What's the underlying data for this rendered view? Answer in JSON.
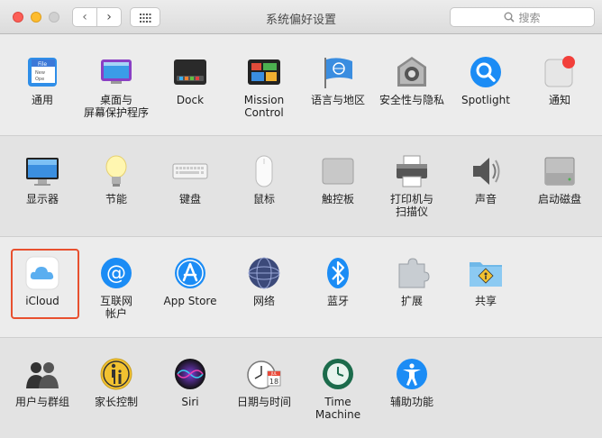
{
  "window": {
    "title": "系统偏好设置"
  },
  "toolbar": {
    "back": "‹",
    "forward": "›"
  },
  "search": {
    "placeholder": "搜索"
  },
  "rows": [
    [
      {
        "id": "general",
        "label": "通用",
        "icon": "general-icon",
        "thumb": [
          "File",
          "New",
          "Ope"
        ]
      },
      {
        "id": "desktop",
        "label": "桌面与\n屏幕保护程序",
        "icon": "desktop-screensaver-icon"
      },
      {
        "id": "dock",
        "label": "Dock",
        "icon": "dock-icon"
      },
      {
        "id": "mission",
        "label": "Mission\nControl",
        "icon": "mission-control-icon"
      },
      {
        "id": "language",
        "label": "语言与地区",
        "icon": "language-region-icon"
      },
      {
        "id": "security",
        "label": "安全性与隐私",
        "icon": "security-privacy-icon"
      },
      {
        "id": "spotlight",
        "label": "Spotlight",
        "icon": "spotlight-icon"
      },
      {
        "id": "notifications",
        "label": "通知",
        "icon": "notifications-icon"
      }
    ],
    [
      {
        "id": "displays",
        "label": "显示器",
        "icon": "displays-icon"
      },
      {
        "id": "energy",
        "label": "节能",
        "icon": "energy-saver-icon"
      },
      {
        "id": "keyboard",
        "label": "键盘",
        "icon": "keyboard-icon"
      },
      {
        "id": "mouse",
        "label": "鼠标",
        "icon": "mouse-icon"
      },
      {
        "id": "trackpad",
        "label": "触控板",
        "icon": "trackpad-icon"
      },
      {
        "id": "printers",
        "label": "打印机与\n扫描仪",
        "icon": "printer-scanner-icon"
      },
      {
        "id": "sound",
        "label": "声音",
        "icon": "sound-icon"
      },
      {
        "id": "startup",
        "label": "启动磁盘",
        "icon": "startup-disk-icon"
      }
    ],
    [
      {
        "id": "icloud",
        "label": "iCloud",
        "icon": "icloud-icon"
      },
      {
        "id": "internet",
        "label": "互联网\n帐户",
        "icon": "internet-accounts-icon"
      },
      {
        "id": "appstore",
        "label": "App Store",
        "icon": "app-store-icon"
      },
      {
        "id": "network",
        "label": "网络",
        "icon": "network-icon"
      },
      {
        "id": "bluetooth",
        "label": "蓝牙",
        "icon": "bluetooth-icon"
      },
      {
        "id": "extensions",
        "label": "扩展",
        "icon": "extensions-icon"
      },
      {
        "id": "sharing",
        "label": "共享",
        "icon": "sharing-icon"
      }
    ],
    [
      {
        "id": "users",
        "label": "用户与群组",
        "icon": "users-groups-icon"
      },
      {
        "id": "parental",
        "label": "家长控制",
        "icon": "parental-controls-icon"
      },
      {
        "id": "siri",
        "label": "Siri",
        "icon": "siri-icon"
      },
      {
        "id": "datetime",
        "label": "日期与时间",
        "icon": "date-time-icon",
        "calendar": {
          "month": "JUL",
          "day": "18"
        }
      },
      {
        "id": "timemachine",
        "label": "Time Machine",
        "icon": "time-machine-icon"
      },
      {
        "id": "accessibility",
        "label": "辅助功能",
        "icon": "accessibility-icon"
      }
    ]
  ],
  "colors": {
    "accent": "#1b8cf5",
    "selection_outline": "#e8502f"
  }
}
